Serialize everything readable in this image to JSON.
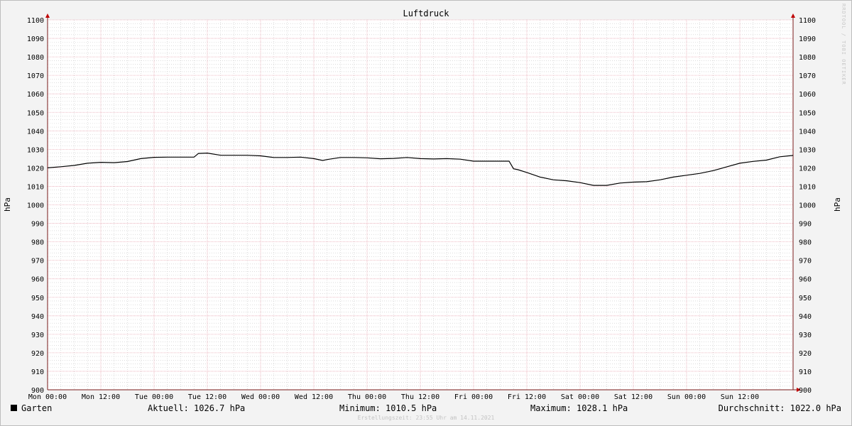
{
  "chart_data": {
    "type": "line",
    "title": "Luftdruck",
    "ylabel": "hPa",
    "ylabel_right": "hPa",
    "ylim": [
      900,
      1100
    ],
    "ytick_labels": [
      "900",
      "910",
      "920",
      "930",
      "940",
      "950",
      "960",
      "970",
      "980",
      "990",
      "1000",
      "1010",
      "1020",
      "1030",
      "1040",
      "1050",
      "1060",
      "1070",
      "1080",
      "1090",
      "1100"
    ],
    "x_range_hours": [
      0,
      168
    ],
    "xtick_labels": [
      "Mon 00:00",
      "Mon 12:00",
      "Tue 00:00",
      "Tue 12:00",
      "Wed 00:00",
      "Wed 12:00",
      "Thu 00:00",
      "Thu 12:00",
      "Fri 00:00",
      "Fri 12:00",
      "Sat 00:00",
      "Sat 12:00",
      "Sun 00:00",
      "Sun 12:00"
    ],
    "grid": true,
    "colors": {
      "line": "#000000",
      "grid_major": "#e8a8b4",
      "grid_minor": "#c8c8c8",
      "axis": "#7a1a1a",
      "arrow": "#c00000",
      "background": "#ffffff"
    },
    "series": [
      {
        "name": "Garten",
        "x": [
          0,
          3,
          6,
          9,
          12,
          15,
          18,
          21,
          24,
          27,
          30,
          33,
          34,
          36,
          39,
          42,
          45,
          48,
          51,
          54,
          57,
          60,
          62,
          63,
          66,
          69,
          72,
          75,
          78,
          81,
          84,
          87,
          90,
          93,
          96,
          99,
          102,
          104,
          105,
          106,
          108,
          111,
          114,
          117,
          120,
          123,
          126,
          129,
          132,
          135,
          138,
          141,
          144,
          147,
          150,
          153,
          156,
          159,
          162,
          165,
          168
        ],
        "y": [
          1020.0,
          1020.6,
          1021.3,
          1022.5,
          1023.0,
          1022.8,
          1023.4,
          1025.0,
          1025.7,
          1025.8,
          1025.8,
          1025.8,
          1027.8,
          1028.0,
          1026.8,
          1026.8,
          1026.8,
          1026.5,
          1025.6,
          1025.6,
          1025.8,
          1025.0,
          1024.0,
          1024.5,
          1025.6,
          1025.6,
          1025.4,
          1024.9,
          1025.1,
          1025.6,
          1025.0,
          1024.8,
          1025.0,
          1024.7,
          1023.6,
          1023.6,
          1023.6,
          1023.6,
          1019.5,
          1019.0,
          1017.5,
          1015.0,
          1013.5,
          1013.0,
          1012.0,
          1010.5,
          1010.5,
          1011.8,
          1012.3,
          1012.5,
          1013.5,
          1015.0,
          1016.0,
          1017.0,
          1018.5,
          1020.5,
          1022.5,
          1023.5,
          1024.2,
          1026.0,
          1026.7
        ]
      }
    ]
  },
  "legend": {
    "series_label": "Garten",
    "current": "Aktuell: 1026.7 hPa",
    "minimum": "Minimum: 1010.5 hPa",
    "maximum": "Maximum: 1028.1 hPa",
    "average": "Durchschnitt: 1022.0 hPa"
  },
  "footer": "Erstellungszeit: 23:55 Uhr am 14.11.2021",
  "watermark": "RRDTOOL / TOBI OETIKER"
}
